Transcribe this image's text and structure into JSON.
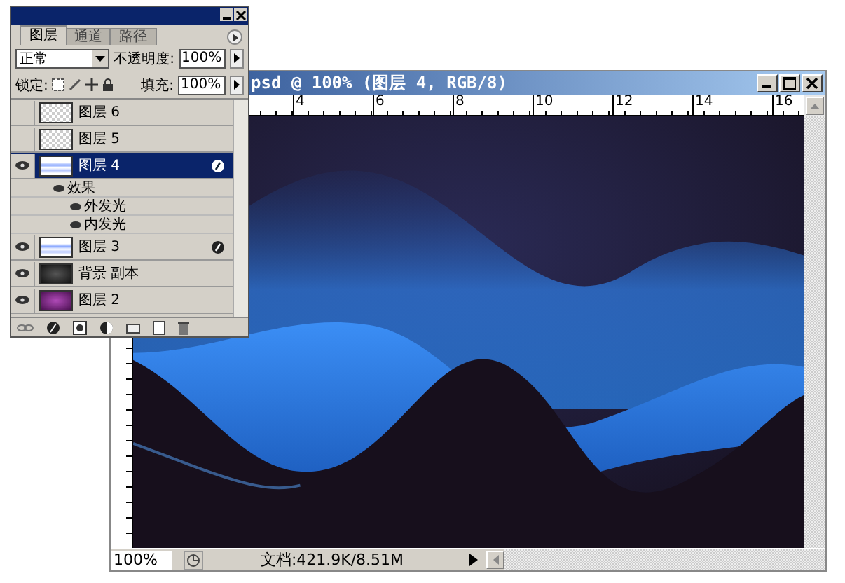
{
  "layers_panel": {
    "tabs": [
      {
        "label": "图层",
        "selected": true
      },
      {
        "label": "通道",
        "selected": false
      },
      {
        "label": "路径",
        "selected": false
      }
    ],
    "blend_mode": "正常",
    "opacity_label": "不透明度:",
    "opacity": "100%",
    "lock_label": "锁定:",
    "fill_label": "填充:",
    "fill": "100%",
    "layers": [
      {
        "name": "图层 6",
        "visible": false,
        "selected": false,
        "fx": false,
        "kind": "checker"
      },
      {
        "name": "图层 5",
        "visible": false,
        "selected": false,
        "fx": false,
        "kind": "checker"
      },
      {
        "name": "图层 4",
        "visible": true,
        "selected": true,
        "fx": true,
        "kind": "wave",
        "children": [
          {
            "name": "效果",
            "visible": true,
            "children": [
              {
                "name": "外发光",
                "visible": true
              },
              {
                "name": "内发光",
                "visible": true
              }
            ]
          }
        ]
      },
      {
        "name": "图层 3",
        "visible": true,
        "selected": false,
        "fx": true,
        "kind": "wave"
      },
      {
        "name": "背景 副本",
        "visible": true,
        "selected": false,
        "fx": false,
        "kind": "dark"
      },
      {
        "name": "图层 2",
        "visible": true,
        "selected": false,
        "fx": false,
        "kind": "purple"
      }
    ]
  },
  "document": {
    "title": "psd @ 100% (图层 4, RGB/8)",
    "ruler_labels": [
      "4",
      "6",
      "8",
      "10",
      "12",
      "14",
      "16"
    ],
    "zoom": "100%",
    "status": "文档:421.9K/8.51M"
  }
}
